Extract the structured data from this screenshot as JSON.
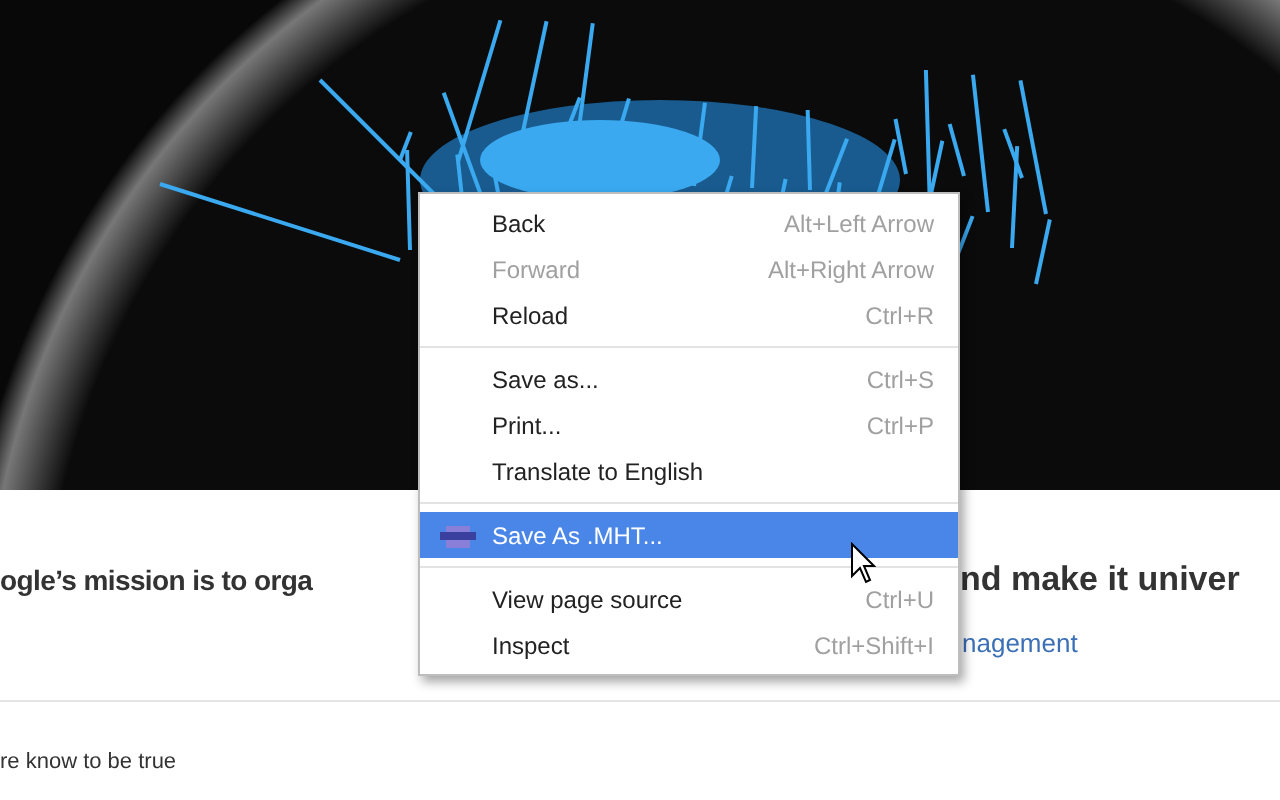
{
  "page": {
    "heading_left": "ogle’s mission is to orga",
    "heading_right": "nd make it univer",
    "link": "nagement",
    "body_text": "re know to be true"
  },
  "context_menu": {
    "items": [
      {
        "kind": "item",
        "label": "Back",
        "shortcut": "Alt+Left Arrow",
        "disabled": false,
        "selected": false
      },
      {
        "kind": "item",
        "label": "Forward",
        "shortcut": "Alt+Right Arrow",
        "disabled": true,
        "selected": false
      },
      {
        "kind": "item",
        "label": "Reload",
        "shortcut": "Ctrl+R",
        "disabled": false,
        "selected": false
      },
      {
        "kind": "separator"
      },
      {
        "kind": "item",
        "label": "Save as...",
        "shortcut": "Ctrl+S",
        "disabled": false,
        "selected": false
      },
      {
        "kind": "item",
        "label": "Print...",
        "shortcut": "Ctrl+P",
        "disabled": false,
        "selected": false
      },
      {
        "kind": "item",
        "label": "Translate to English",
        "disabled": false,
        "selected": false
      },
      {
        "kind": "separator"
      },
      {
        "kind": "extension",
        "label": "Save As .MHT...",
        "disabled": false,
        "selected": true
      },
      {
        "kind": "separator"
      },
      {
        "kind": "item",
        "label": "View page source",
        "shortcut": "Ctrl+U",
        "disabled": false,
        "selected": false
      },
      {
        "kind": "item",
        "label": "Inspect",
        "shortcut": "Ctrl+Shift+I",
        "disabled": false,
        "selected": false
      }
    ]
  }
}
